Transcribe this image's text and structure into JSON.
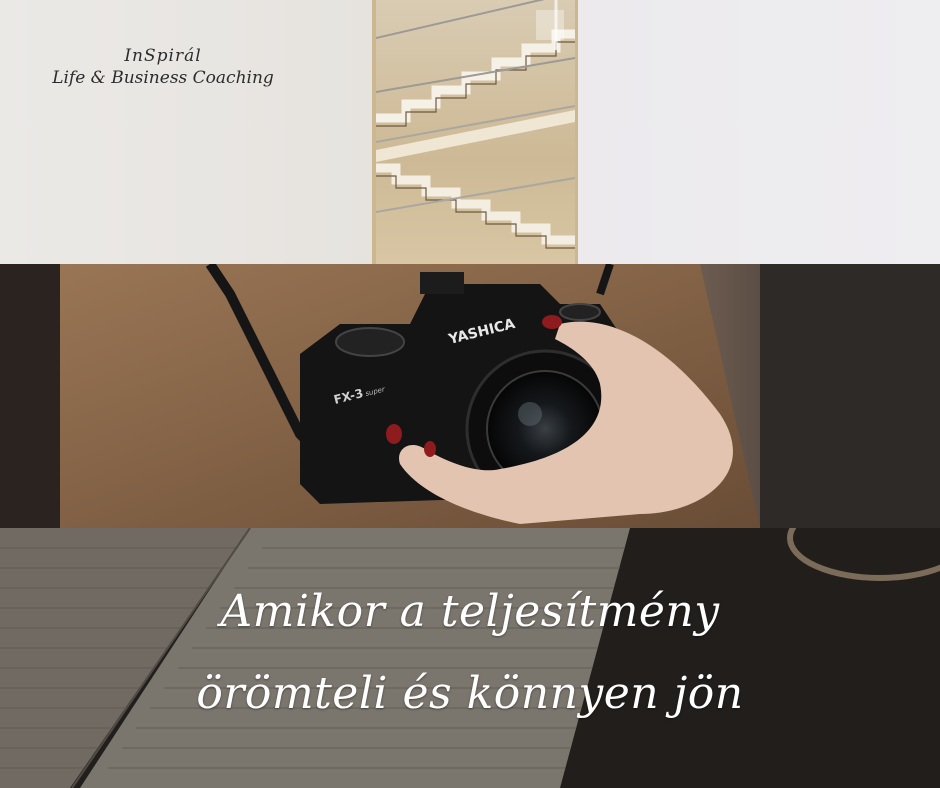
{
  "logo": {
    "line1": "InSpirál",
    "line2": "Life & Business Coaching"
  },
  "headline": {
    "line1": "Amikor a teljesítmény",
    "line2": "örömteli és könnyen jön"
  },
  "camera": {
    "brand": "YASHICA",
    "model": "FX-3",
    "model_suffix": "super"
  },
  "colors": {
    "top_bg": "#e9e7e4",
    "sweater": "#8c6a4c",
    "nails": "#8e1c1e",
    "bottom_bg": "#2b2826",
    "headline": "#ffffff"
  }
}
